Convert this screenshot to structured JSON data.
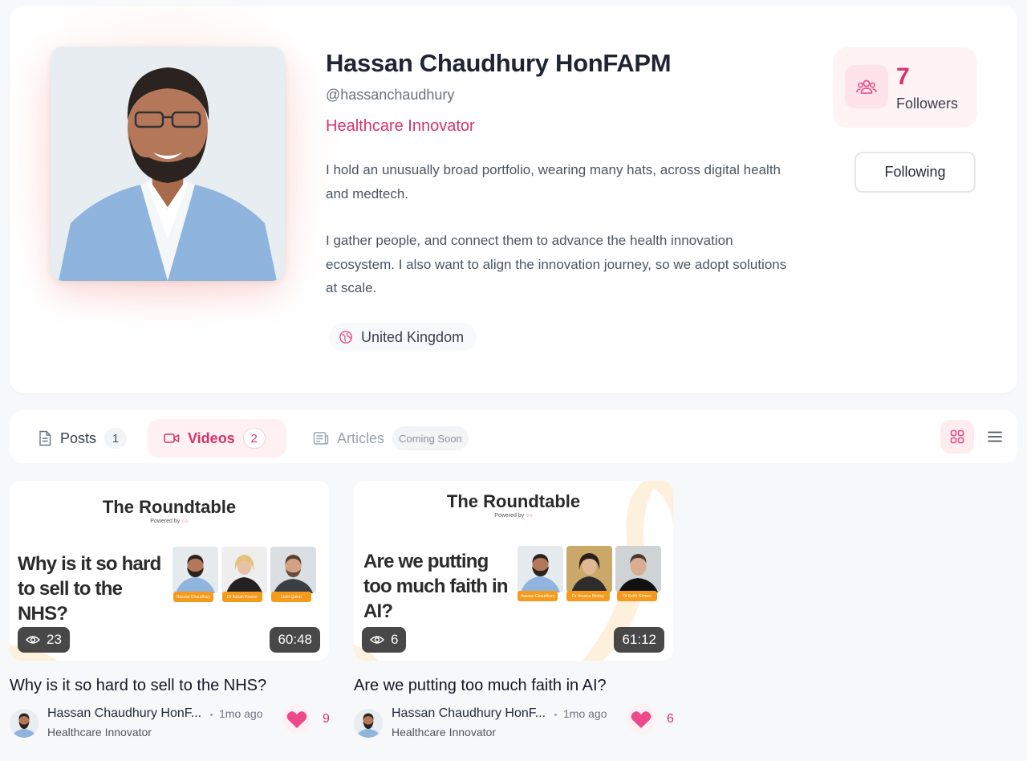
{
  "profile": {
    "name": "Hassan Chaudhury HonFAPM",
    "handle": "@hassanchaudhury",
    "headline": "Healthcare Innovator",
    "bio": [
      "I hold an unusually broad portfolio, wearing many hats, across digital health and medtech.",
      "I gather people, and connect them to advance the health innovation ecosystem. I also want to align the innovation journey, so we adopt solutions at scale."
    ],
    "location": "United Kingdom",
    "followers_count": "7",
    "followers_label": "Followers",
    "follow_button_label": "Following"
  },
  "tabs": [
    {
      "label": "Posts",
      "count": "1",
      "icon": "document-icon",
      "active": false
    },
    {
      "label": "Videos",
      "count": "2",
      "icon": "video-camera-icon",
      "active": true
    },
    {
      "label": "Articles",
      "badge": "Coming Soon",
      "icon": "newspaper-icon",
      "active": false
    }
  ],
  "view_toggle": {
    "grid_icon": "grid-icon",
    "list_icon": "list-icon",
    "active": "grid"
  },
  "videos": [
    {
      "thumb_title": "The Roundtable",
      "thumb_powered": "Powered by",
      "thumb_question": "Why is it so hard to sell to the NHS?",
      "guests": [
        "Hassan Chaudhury",
        "Dr Ashah Pearse",
        "Liam Quinn"
      ],
      "views": "23",
      "duration": "60:48",
      "title": "Why is it so hard to sell to the NHS?",
      "author": "Hassan Chaudhury HonF...",
      "author_headline": "Healthcare Innovator",
      "time": "1mo ago",
      "likes": "9"
    },
    {
      "thumb_title": "The Roundtable",
      "thumb_powered": "Powered by",
      "thumb_question": "Are we putting too much faith in AI?",
      "guests": [
        "Hassan Chaudhury",
        "Dr Jessica Morley",
        "Dr Keith Grimes"
      ],
      "views": "6",
      "duration": "61:12",
      "title": "Are we putting too much faith in AI?",
      "author": "Hassan Chaudhury HonF...",
      "author_headline": "Healthcare Innovator",
      "time": "1mo ago",
      "likes": "6"
    }
  ],
  "colors": {
    "accent": "#d6336c",
    "accent_soft": "#fff0f3",
    "guest_tag": "#f59a1b",
    "blazer": "#8fb4de"
  }
}
